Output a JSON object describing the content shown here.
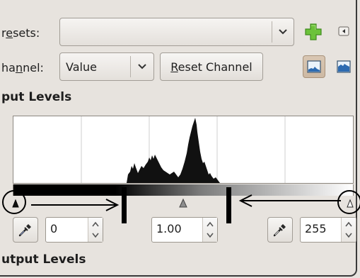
{
  "presets": {
    "label_pre": "r",
    "label_mnemonic": "e",
    "label_post": "sets:",
    "value": ""
  },
  "channel": {
    "label_pre": "ha",
    "label_mnemonic": "n",
    "label_post": "nel:",
    "value": "Value",
    "reset_pre": "",
    "reset_mnemonic": "R",
    "reset_post": "eset Channel"
  },
  "input_levels": {
    "title": "put Levels",
    "low_value": "0",
    "gamma_value": "1.00",
    "high_value": "255"
  },
  "output_levels": {
    "title": "utput Levels"
  },
  "colors": {
    "accent_add": "#5bb532",
    "histogram_fill": "#111111",
    "annotation": "#000000"
  }
}
